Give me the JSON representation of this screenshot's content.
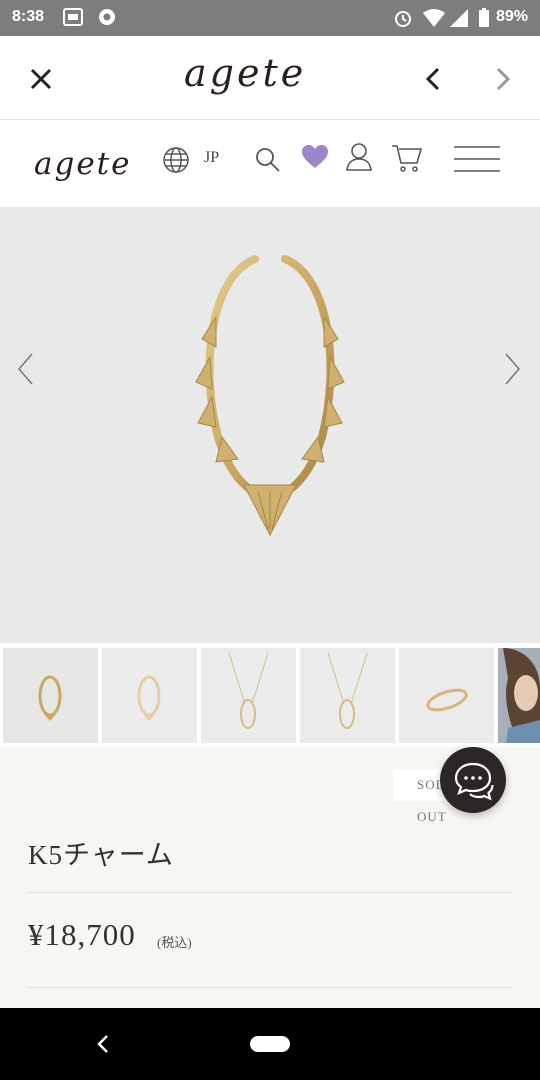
{
  "status_bar": {
    "time": "8:38",
    "battery": "89%",
    "icons": [
      "notification-icon",
      "chrome-icon",
      "alarm-icon",
      "wifi-icon",
      "signal-icon",
      "battery-icon"
    ]
  },
  "browser": {
    "logo_text": "agete",
    "icons": [
      "close-icon",
      "back-icon",
      "forward-icon"
    ]
  },
  "header": {
    "logo_text": "agete",
    "language": "JP",
    "icons": [
      "globe-icon",
      "search-icon",
      "heart-icon",
      "user-icon",
      "cart-icon",
      "menu-icon"
    ],
    "heart_color": "#9b86c8"
  },
  "gallery": {
    "icons": [
      "chevron-left-icon",
      "chevron-right-icon"
    ],
    "thumbnails": [
      "charm-front",
      "charm-light",
      "necklace-1",
      "necklace-2",
      "charm-side",
      "model-photo"
    ],
    "selected_index": 0
  },
  "product": {
    "status_badge": "SOLD OUT",
    "name": "K5チャーム",
    "price": "¥18,700",
    "tax_label": "(税込)"
  },
  "chat": {
    "icon": "chat-icon"
  },
  "nav": {
    "icons": [
      "nav-back-icon",
      "home-pill"
    ]
  }
}
